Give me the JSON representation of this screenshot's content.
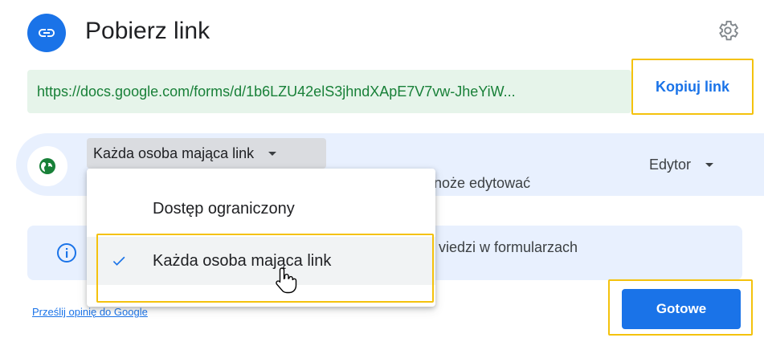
{
  "header": {
    "title": "Pobierz link",
    "link_icon": "link-icon",
    "settings_icon": "gear-icon"
  },
  "link": {
    "url": "https://docs.google.com/forms/d/1b6LZU42elS3jhndXApE7V7vw-JheYiW...",
    "copy_label": "Kopiuj link"
  },
  "access": {
    "icon": "globe-icon",
    "selected": "Każda osoba mająca link",
    "description_partial": "noże edytować",
    "role": "Edytor"
  },
  "menu": {
    "items": [
      {
        "label": "Dostęp ograniczony",
        "selected": false
      },
      {
        "label": "Każda osoba mająca link",
        "selected": true
      }
    ]
  },
  "info": {
    "icon": "info-icon",
    "text_partial": "viedzi w formularzach"
  },
  "footer": {
    "feedback": "Prześlij opinię do Google",
    "done_label": "Gotowe"
  },
  "colors": {
    "accent": "#1a73e8",
    "link_green": "#188038",
    "link_bg": "#e6f4ea",
    "panel_bg": "#e8f0fe",
    "highlight": "#f4c20d"
  }
}
